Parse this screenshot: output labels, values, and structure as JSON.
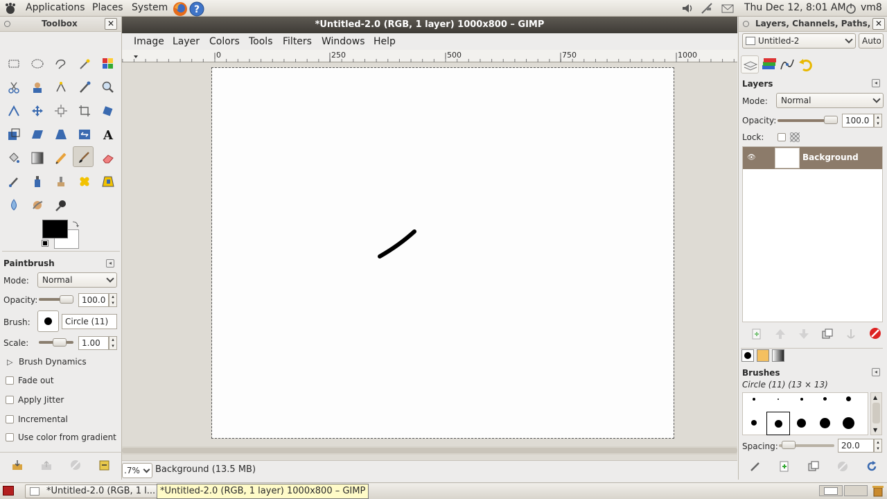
{
  "top_panel": {
    "menus": [
      "Applications",
      "Places",
      "System"
    ],
    "datetime": "Thu Dec 12,  8:01 AM",
    "user": "vm8",
    "icons": [
      "firefox-icon",
      "help-icon",
      "volume-icon",
      "network-icon",
      "mail-icon"
    ]
  },
  "toolbox": {
    "title": "Toolbox",
    "tool_options_title": "Paintbrush",
    "mode_label": "Mode:",
    "mode_value": "Normal",
    "opacity_label": "Opacity:",
    "opacity_value": "100.0",
    "brush_label": "Brush:",
    "brush_value": "Circle (11)",
    "scale_label": "Scale:",
    "scale_value": "1.00",
    "brush_dynamics": "Brush Dynamics",
    "options": [
      "Fade out",
      "Apply Jitter",
      "Incremental",
      "Use color from gradient"
    ],
    "fg_color": "#000000",
    "bg_color": "#ffffff"
  },
  "image_window": {
    "title": "*Untitled-2.0 (RGB, 1 layer) 1000x800 – GIMP",
    "menus": [
      "Image",
      "Layer",
      "Colors",
      "Tools",
      "Filters",
      "Windows",
      "Help"
    ],
    "ruler_ticks": [
      "0",
      "250",
      "500",
      "750",
      "1000"
    ],
    "zoom": ".7%",
    "status": "Background (13.5 MB)"
  },
  "right_dock": {
    "title": "Layers, Channels, Paths, U",
    "image_select": "Untitled-2",
    "auto_button": "Auto",
    "layers_title": "Layers",
    "mode_label": "Mode:",
    "mode_value": "Normal",
    "opacity_label": "Opacity:",
    "opacity_value": "100.0",
    "lock_label": "Lock:",
    "layer_name": "Background",
    "brushes_title": "Brushes",
    "brush_name": "Circle (11) (13 × 13)",
    "spacing_label": "Spacing:",
    "spacing_value": "20.0"
  },
  "taskbar": {
    "task1": "*Untitled-2.0 (RGB, 1 l...",
    "tooltip": "*Untitled-2.0 (RGB, 1 layer) 1000x800 – GIMP"
  }
}
